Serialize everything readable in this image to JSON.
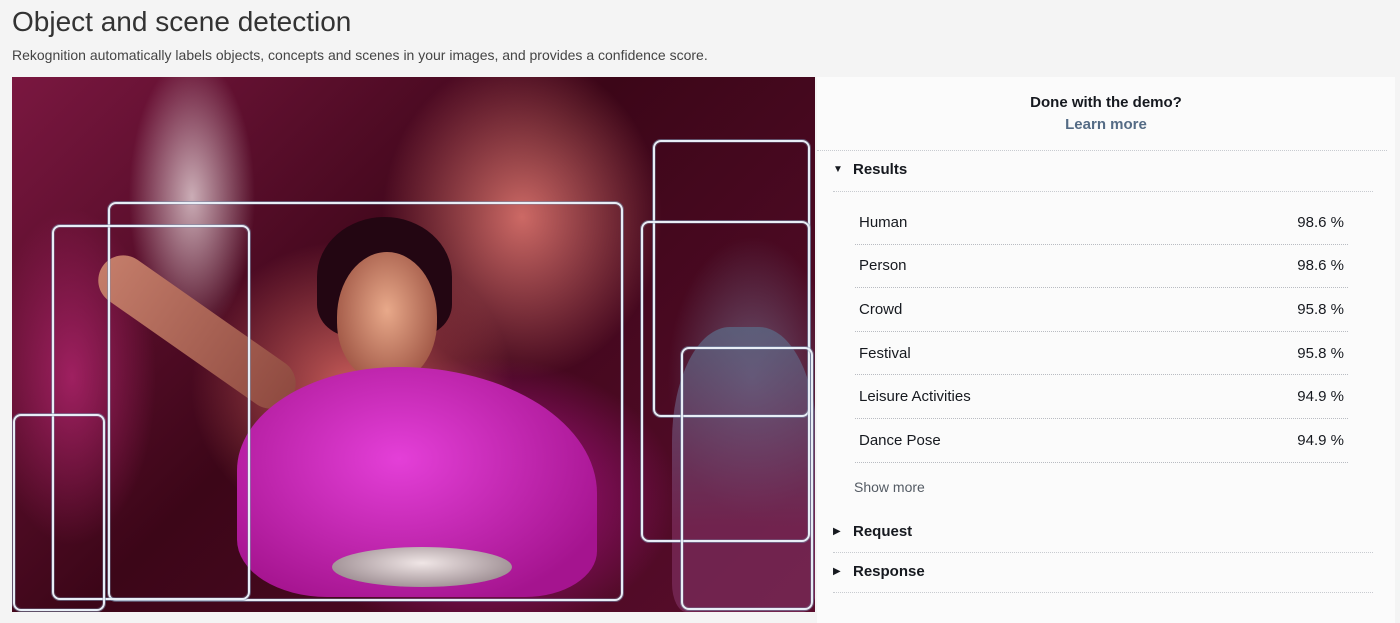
{
  "header": {
    "title": "Object and scene detection",
    "subtitle": "Rekognition automatically labels objects, concepts and scenes in your images, and provides a confidence score."
  },
  "cta": {
    "question": "Done with the demo?",
    "link": "Learn more"
  },
  "results": {
    "label": "Results",
    "expanded": true,
    "items": [
      {
        "label": "Human",
        "confidence": "98.6 %"
      },
      {
        "label": "Person",
        "confidence": "98.6 %"
      },
      {
        "label": "Crowd",
        "confidence": "95.8 %"
      },
      {
        "label": "Festival",
        "confidence": "95.8 %"
      },
      {
        "label": "Leisure Activities",
        "confidence": "94.9 %"
      },
      {
        "label": "Dance Pose",
        "confidence": "94.9 %"
      }
    ],
    "show_more": "Show more"
  },
  "request": {
    "label": "Request",
    "expanded": false
  },
  "response": {
    "label": "Response",
    "expanded": false
  }
}
